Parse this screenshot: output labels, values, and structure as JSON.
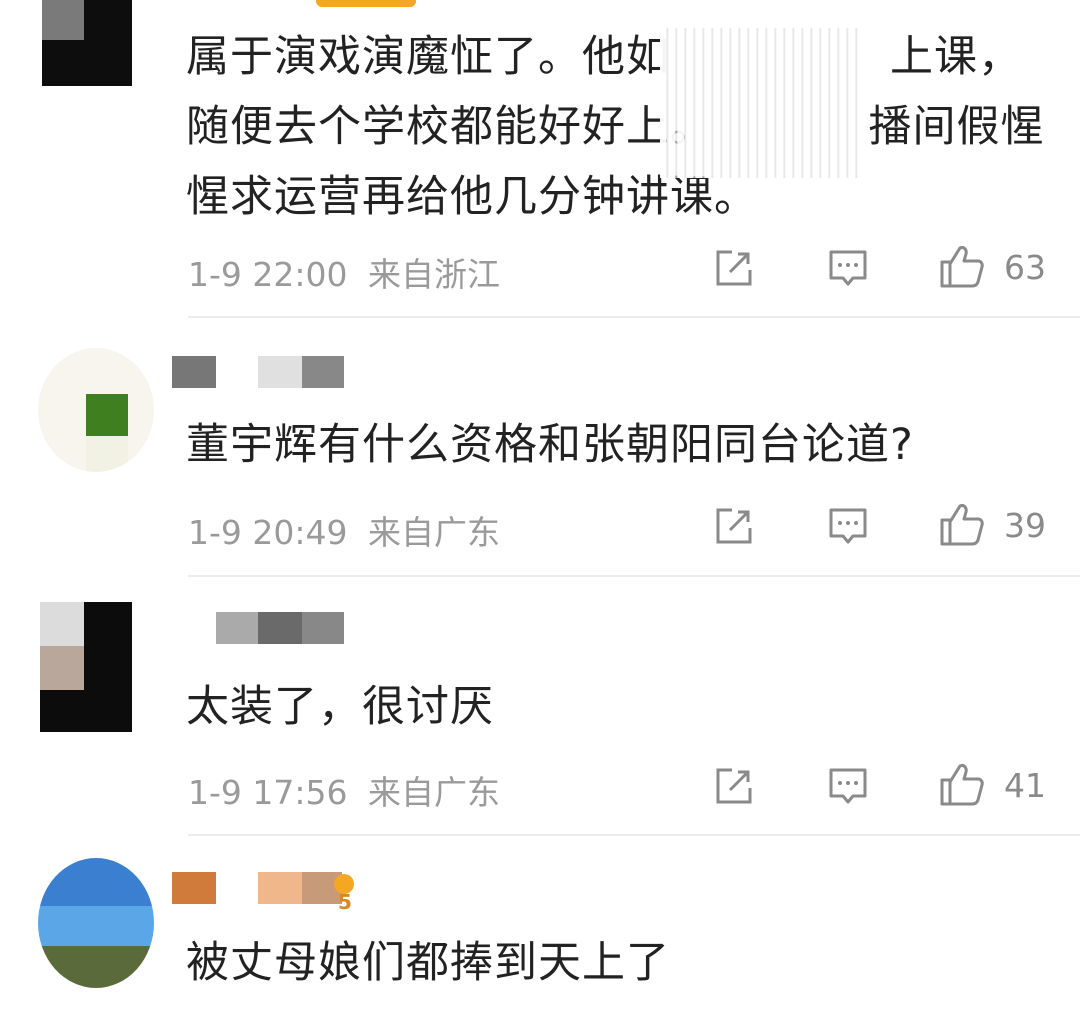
{
  "comments": [
    {
      "text": "属于演戏演魔怔了。他如　　　　　上课，随便去个学校都能好好上。　　　　播间假惺惺求运营再给他几分钟讲课。",
      "time": "1-9 22:00",
      "location": "来自浙江",
      "likes": "63"
    },
    {
      "text": "董宇辉有什么资格和张朝阳同台论道?",
      "time": "1-9 20:49",
      "location": "来自广东",
      "likes": "39"
    },
    {
      "text": "太装了，很讨厌",
      "time": "1-9 17:56",
      "location": "来自广东",
      "likes": "41"
    },
    {
      "text": "被丈母娘们都捧到天上了",
      "badge_level": "5"
    }
  ],
  "icons": {
    "share": "share-icon",
    "reply": "comment-icon",
    "like": "thumbs-up-icon"
  },
  "colors": {
    "meta": "#9a9a9a",
    "text": "#222222",
    "divider": "#ececec",
    "accent": "#f5a623"
  }
}
